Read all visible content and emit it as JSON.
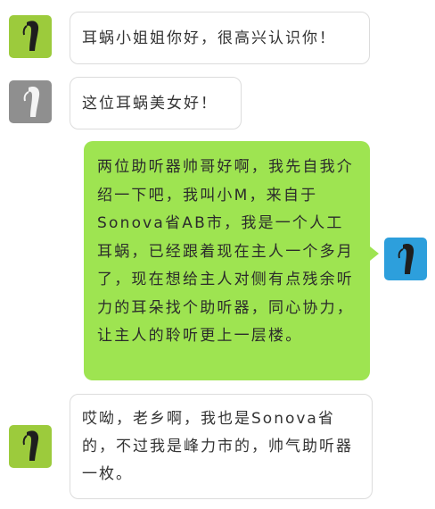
{
  "colors": {
    "outgoing_bubble": "#9ee451",
    "incoming_bubble": "#ffffff",
    "bubble_border": "#dcdcdc",
    "avatar_green": "#9ccb3c",
    "avatar_gray": "#8f8f8f",
    "avatar_blue": "#2d9fdc"
  },
  "messages": [
    {
      "side": "left",
      "avatar_icon": "black-hearing-aid-icon",
      "text": "耳蜗小姐姐你好，很高兴认识你！"
    },
    {
      "side": "left",
      "avatar_icon": "white-hearing-aid-icon",
      "text": "这位耳蜗美女好！"
    },
    {
      "side": "right",
      "avatar_icon": "black-hearing-aid-icon",
      "text": "两位助听器帅哥好啊，我先自我介绍一下吧，我叫小M，来自于Sonova省AB市，我是一个人工耳蜗，已经跟着现在主人一个多月了，现在想给主人对侧有点残余听力的耳朵找个助听器，同心协力，让主人的聆听更上一层楼。"
    },
    {
      "side": "left",
      "avatar_icon": "black-hearing-aid-icon",
      "text": "哎呦，老乡啊，我也是Sonova省的，不过我是峰力市的，帅气助听器一枚。"
    }
  ]
}
